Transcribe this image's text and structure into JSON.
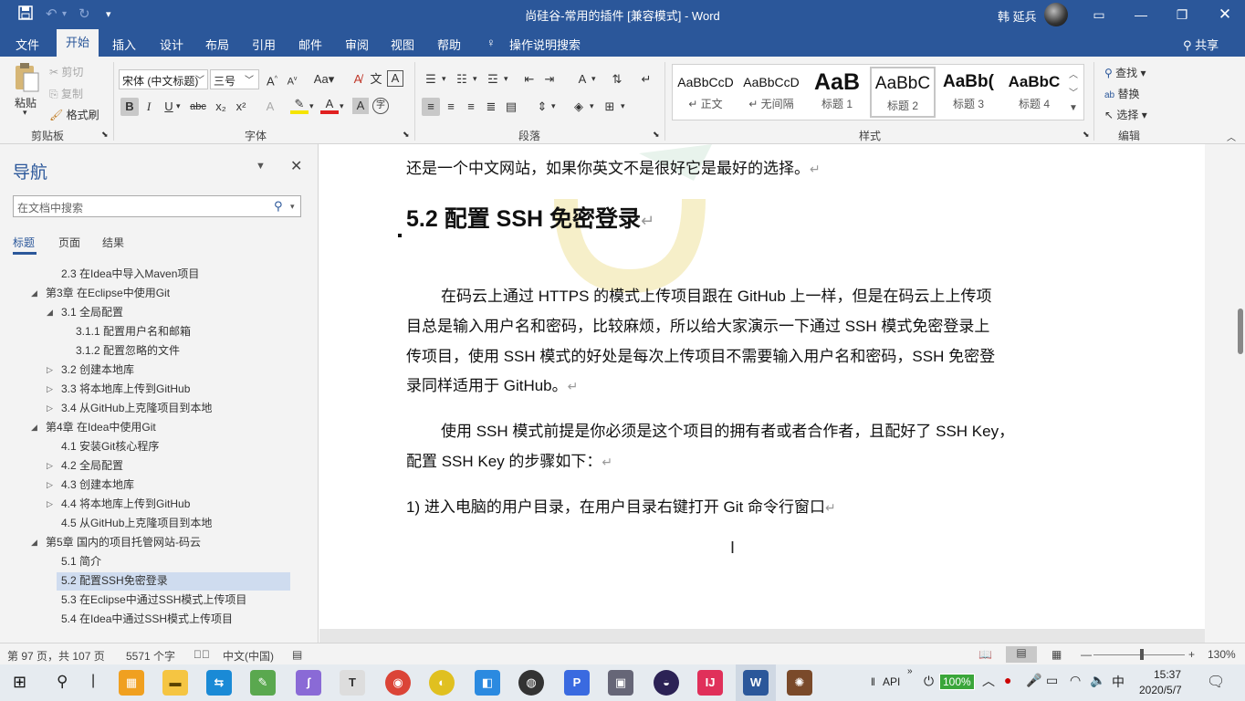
{
  "titlebar": {
    "doc_title": "尚硅谷-常用的插件 [兼容模式]  -  Word",
    "user_name": "韩 延兵"
  },
  "ribbon_tabs": [
    "文件",
    "开始",
    "插入",
    "设计",
    "布局",
    "引用",
    "邮件",
    "审阅",
    "视图",
    "帮助"
  ],
  "ribbon": {
    "tell_me": "操作说明搜索",
    "share": "共享",
    "clipboard": {
      "paste": "粘贴",
      "cut": "剪切",
      "copy": "复制",
      "format_painter": "格式刷",
      "label": "剪贴板"
    },
    "font": {
      "name": "宋体 (中文标题)",
      "size": "三号",
      "label": "字体",
      "bold": "B",
      "italic": "I",
      "underline": "U",
      "strike": "abc",
      "sub": "x₂",
      "sup": "x²",
      "aa": "Aa"
    },
    "paragraph": {
      "label": "段落"
    },
    "styles": {
      "label": "样式",
      "items": [
        {
          "preview": "AaBbCcD",
          "name": "↵ 正文"
        },
        {
          "preview": "AaBbCcD",
          "name": "↵ 无间隔"
        },
        {
          "preview": "AaB",
          "name": "标题 1"
        },
        {
          "preview": "AaBbC",
          "name": "标题 2"
        },
        {
          "preview": "AaBb(",
          "name": "标题 3"
        },
        {
          "preview": "AaBbC",
          "name": "标题 4"
        }
      ]
    },
    "editing": {
      "find": "查找",
      "replace": "替换",
      "select": "选择",
      "label": "编辑"
    }
  },
  "nav": {
    "title": "导航",
    "search_placeholder": "在文档中搜索",
    "tabs": [
      "标题",
      "页面",
      "结果"
    ],
    "tree": [
      {
        "text": "2.3 在Idea中导入Maven项目",
        "level": 2,
        "tri": ""
      },
      {
        "text": "第3章 在Eclipse中使用Git",
        "level": 1,
        "tri": "◢"
      },
      {
        "text": "3.1 全局配置",
        "level": 2,
        "tri": "◢"
      },
      {
        "text": "3.1.1 配置用户名和邮箱",
        "level": 3,
        "tri": ""
      },
      {
        "text": "3.1.2 配置忽略的文件",
        "level": 3,
        "tri": ""
      },
      {
        "text": "3.2 创建本地库",
        "level": 2,
        "tri": "▷"
      },
      {
        "text": "3.3 将本地库上传到GitHub",
        "level": 2,
        "tri": "▷"
      },
      {
        "text": "3.4 从GitHub上克隆项目到本地",
        "level": 2,
        "tri": "▷"
      },
      {
        "text": "第4章 在Idea中使用Git",
        "level": 1,
        "tri": "◢"
      },
      {
        "text": "4.1 安装Git核心程序",
        "level": 2,
        "tri": ""
      },
      {
        "text": "4.2 全局配置",
        "level": 2,
        "tri": "▷"
      },
      {
        "text": "4.3 创建本地库",
        "level": 2,
        "tri": "▷"
      },
      {
        "text": "4.4 将本地库上传到GitHub",
        "level": 2,
        "tri": "▷"
      },
      {
        "text": "4.5 从GitHub上克隆项目到本地",
        "level": 2,
        "tri": ""
      },
      {
        "text": "第5章 国内的项目托管网站-码云",
        "level": 1,
        "tri": "◢"
      },
      {
        "text": "5.1 简介",
        "level": 2,
        "tri": ""
      },
      {
        "text": "5.2 配置SSH免密登录",
        "level": 2,
        "tri": ""
      },
      {
        "text": "5.3 在Eclipse中通过SSH模式上传项目",
        "level": 2,
        "tri": ""
      },
      {
        "text": "5.4 在Idea中通过SSH模式上传项目",
        "level": 2,
        "tri": ""
      }
    ]
  },
  "document": {
    "line0": "还是一个中文网站，如果你英文不是很好它是最好的选择。",
    "heading": "5.2 配置 SSH 免密登录",
    "p1": [
      "在码云上通过 HTTPS 的模式上传项目跟在 GitHub 上一样，但是在码云上上传项",
      "目总是输入用户名和密码，比较麻烦，所以给大家演示一下通过 SSH 模式免密登录上",
      "传项目，使用 SSH 模式的好处是每次上传项目不需要输入用户名和密码，SSH 免密登",
      "录同样适用于 GitHub。"
    ],
    "p2": [
      "使用 SSH 模式前提是你必须是这个项目的拥有者或者合作者，且配好了 SSH Key，",
      "配置 SSH Key 的步骤如下："
    ],
    "p3": "1)   进入电脑的用户目录，在用户目录右键打开 Git 命令行窗口",
    "para_mark": "↵"
  },
  "status": {
    "page": "第 97 页，共 107 页",
    "words": "5571 个字",
    "lang": "中文(中国)",
    "zoom": "130%"
  },
  "taskbar": {
    "battery": "100%",
    "ime": "中",
    "api": "API",
    "time": "15:37",
    "date": "2020/5/7"
  }
}
